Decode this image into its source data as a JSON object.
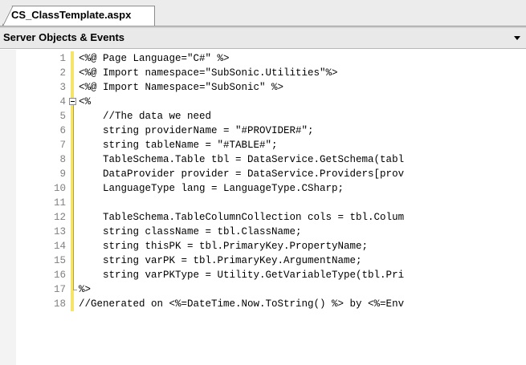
{
  "tab": {
    "label": "CS_ClassTemplate.aspx"
  },
  "object_bar": {
    "label": "Server Objects & Events"
  },
  "editor": {
    "lines": [
      {
        "num": "1",
        "text": "<%@ Page Language=\"C#\" %>"
      },
      {
        "num": "2",
        "text": "<%@ Import namespace=\"SubSonic.Utilities\"%>"
      },
      {
        "num": "3",
        "text": "<%@ Import Namespace=\"SubSonic\" %>"
      },
      {
        "num": "4",
        "text": "<%"
      },
      {
        "num": "5",
        "text": "    //The data we need"
      },
      {
        "num": "6",
        "text": "    string providerName = \"#PROVIDER#\";"
      },
      {
        "num": "7",
        "text": "    string tableName = \"#TABLE#\";"
      },
      {
        "num": "8",
        "text": "    TableSchema.Table tbl = DataService.GetSchema(tabl"
      },
      {
        "num": "9",
        "text": "    DataProvider provider = DataService.Providers[prov"
      },
      {
        "num": "10",
        "text": "    LanguageType lang = LanguageType.CSharp;"
      },
      {
        "num": "11",
        "text": ""
      },
      {
        "num": "12",
        "text": "    TableSchema.TableColumnCollection cols = tbl.Colum"
      },
      {
        "num": "13",
        "text": "    string className = tbl.ClassName;"
      },
      {
        "num": "14",
        "text": "    string thisPK = tbl.PrimaryKey.PropertyName;"
      },
      {
        "num": "15",
        "text": "    string varPK = tbl.PrimaryKey.ArgumentName;"
      },
      {
        "num": "16",
        "text": "    string varPKType = Utility.GetVariableType(tbl.Pri"
      },
      {
        "num": "17",
        "text": "%>"
      },
      {
        "num": "18",
        "text": "//Generated on <%=DateTime.Now.ToString() %> by <%=Env"
      }
    ]
  }
}
